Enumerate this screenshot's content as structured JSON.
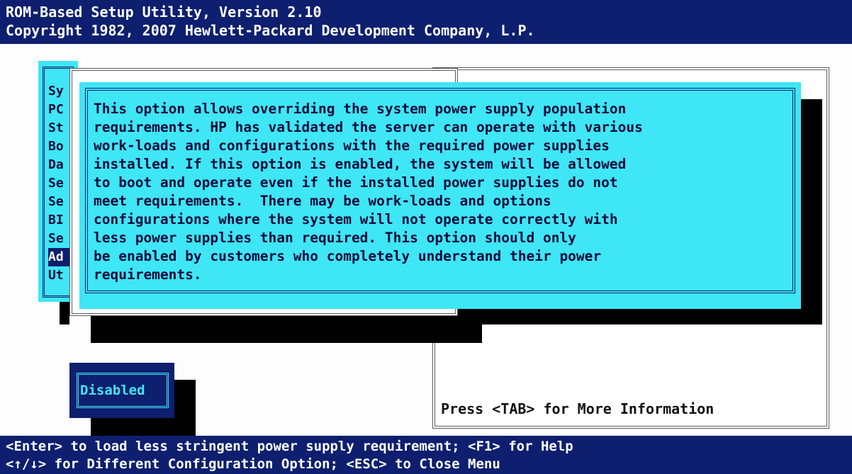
{
  "header": {
    "line1": "ROM-Based Setup Utility, Version 2.10",
    "line2": "Copyright 1982, 2007 Hewlett-Packard Development Company, L.P."
  },
  "main_menu": {
    "items": [
      "Sy",
      "PC",
      "St",
      "Bo",
      "Da",
      "Se",
      "Se",
      "BI",
      "Se",
      "Ad",
      "Ut"
    ],
    "selected_index": 9
  },
  "help_text": [
    "This option allows overriding the system power supply population",
    "requirements. HP has validated the server can operate with various",
    "work-loads and configurations with the required power supplies",
    "installed. If this option is enabled, the system will be allowed",
    "to boot and operate even if the installed power supplies do not",
    "meet requirements.  There may be work-loads and options",
    "configurations where the system will not operate correctly with",
    "less power supplies than required. This option should only",
    "be enabled by customers who completely understand their power",
    "requirements."
  ],
  "option_value": "Disabled",
  "more_info": "Press <TAB> for More Information",
  "footer": {
    "line1": "<Enter> to load less stringent power supply requirement; <F1> for Help",
    "line2": "<↑/↓> for Different Configuration Option; <ESC> to Close Menu"
  },
  "colors": {
    "bios_blue": "#0d1f6e",
    "bios_cyan": "#3fe6f5",
    "background": "#fdfdfd"
  }
}
